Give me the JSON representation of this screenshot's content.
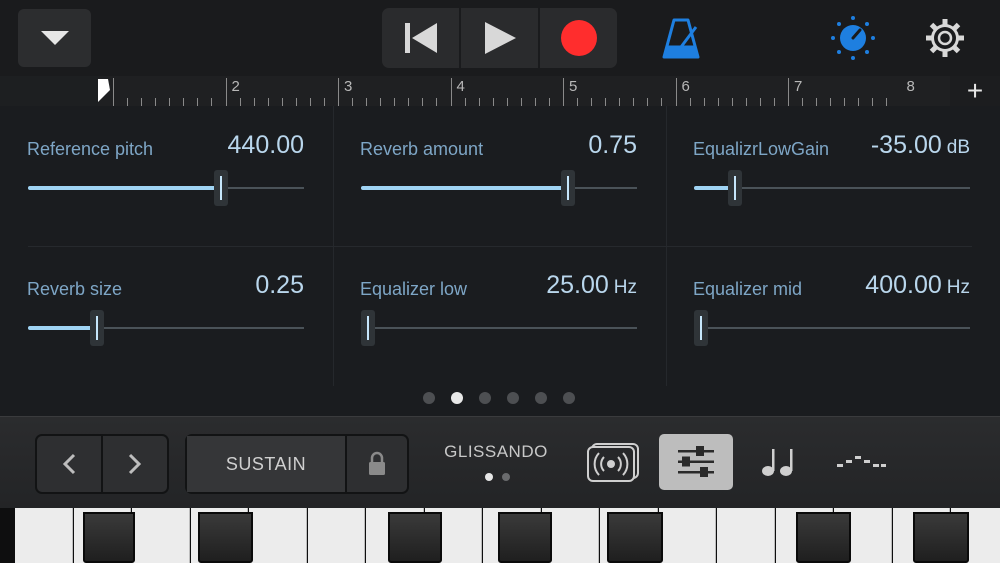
{
  "transport": {
    "icons": [
      "skip-back-icon",
      "play-icon",
      "record-icon"
    ]
  },
  "toolbar": {
    "icons": [
      "dropdown-icon",
      "metronome-icon",
      "master-volume-icon",
      "settings-icon"
    ]
  },
  "ruler": {
    "bars": [
      "2",
      "3",
      "4",
      "5",
      "6",
      "7",
      "8"
    ],
    "add_label": "+"
  },
  "params": [
    {
      "label": "Reference pitch",
      "value": "440.00",
      "unit": "",
      "level": 0.7
    },
    {
      "label": "Reverb amount",
      "value": "0.75",
      "unit": "",
      "level": 0.75
    },
    {
      "label": "EqualizrLowGain",
      "value": "-35.00",
      "unit": "dB",
      "level": 0.15
    },
    {
      "label": "Reverb size",
      "value": "0.25",
      "unit": "",
      "level": 0.25
    },
    {
      "label": "Equalizer low",
      "value": "25.00",
      "unit": "Hz",
      "level": 0.0
    },
    {
      "label": "Equalizer mid",
      "value": "400.00",
      "unit": "Hz",
      "level": 0.02
    }
  ],
  "pager": {
    "count": 6,
    "active": 1
  },
  "controls": {
    "sustain_label": "SUSTAIN",
    "glissando_label": "GLISSANDO",
    "glissando_pages": 2,
    "glissando_active": 0,
    "modes": [
      "sound-icon",
      "controls-icon",
      "notes-icon",
      "arpeggiator-icon"
    ],
    "active_mode": 1
  },
  "colors": {
    "accent_blue": "#1e7fe0",
    "record_red": "#ff2d2d",
    "slider_fill": "#9fd3f3"
  }
}
